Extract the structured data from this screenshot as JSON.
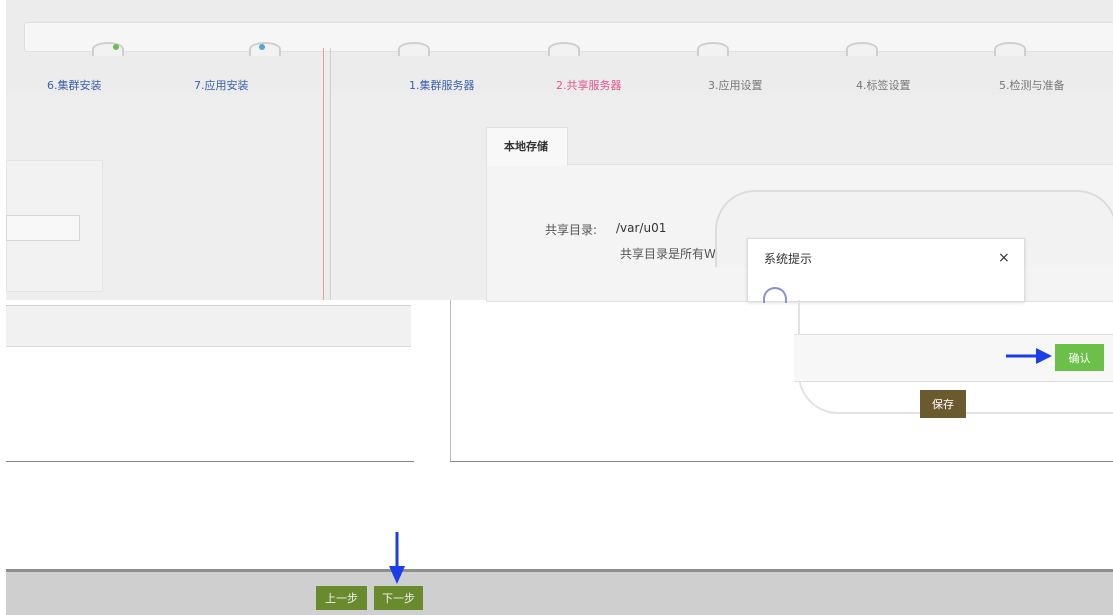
{
  "steps": [
    {
      "label": "6.集群安装",
      "color": "#3a5faa"
    },
    {
      "label": "7.应用安装",
      "color": "#3a5faa"
    },
    {
      "label": "1.集群服务器",
      "color": "#3a5faa"
    },
    {
      "label": "2.共享服务器",
      "color": "#e0548c"
    },
    {
      "label": "3.应用设置",
      "color": "#777777"
    },
    {
      "label": "4.标签设置",
      "color": "#777777"
    },
    {
      "label": "5.检测与准备",
      "color": "#777777"
    }
  ],
  "storage": {
    "tab_label": "本地存储",
    "share_dir_label": "共享目录:",
    "share_dir_value": "/var/u01",
    "share_dir_hint": "共享目录是所有Worker上"
  },
  "dialog": {
    "title": "系统提示",
    "close": "×",
    "confirm_label": "确认"
  },
  "buttons": {
    "save_label": "保存",
    "prev_label": "上一步",
    "next_label": "下一步"
  },
  "colors": {
    "confirm": "#6cc04a",
    "save": "#6b5a2e",
    "nav_buttons": "#6a8a2e",
    "arrow": "#1a3ee8",
    "active_step": "#e0548c"
  }
}
